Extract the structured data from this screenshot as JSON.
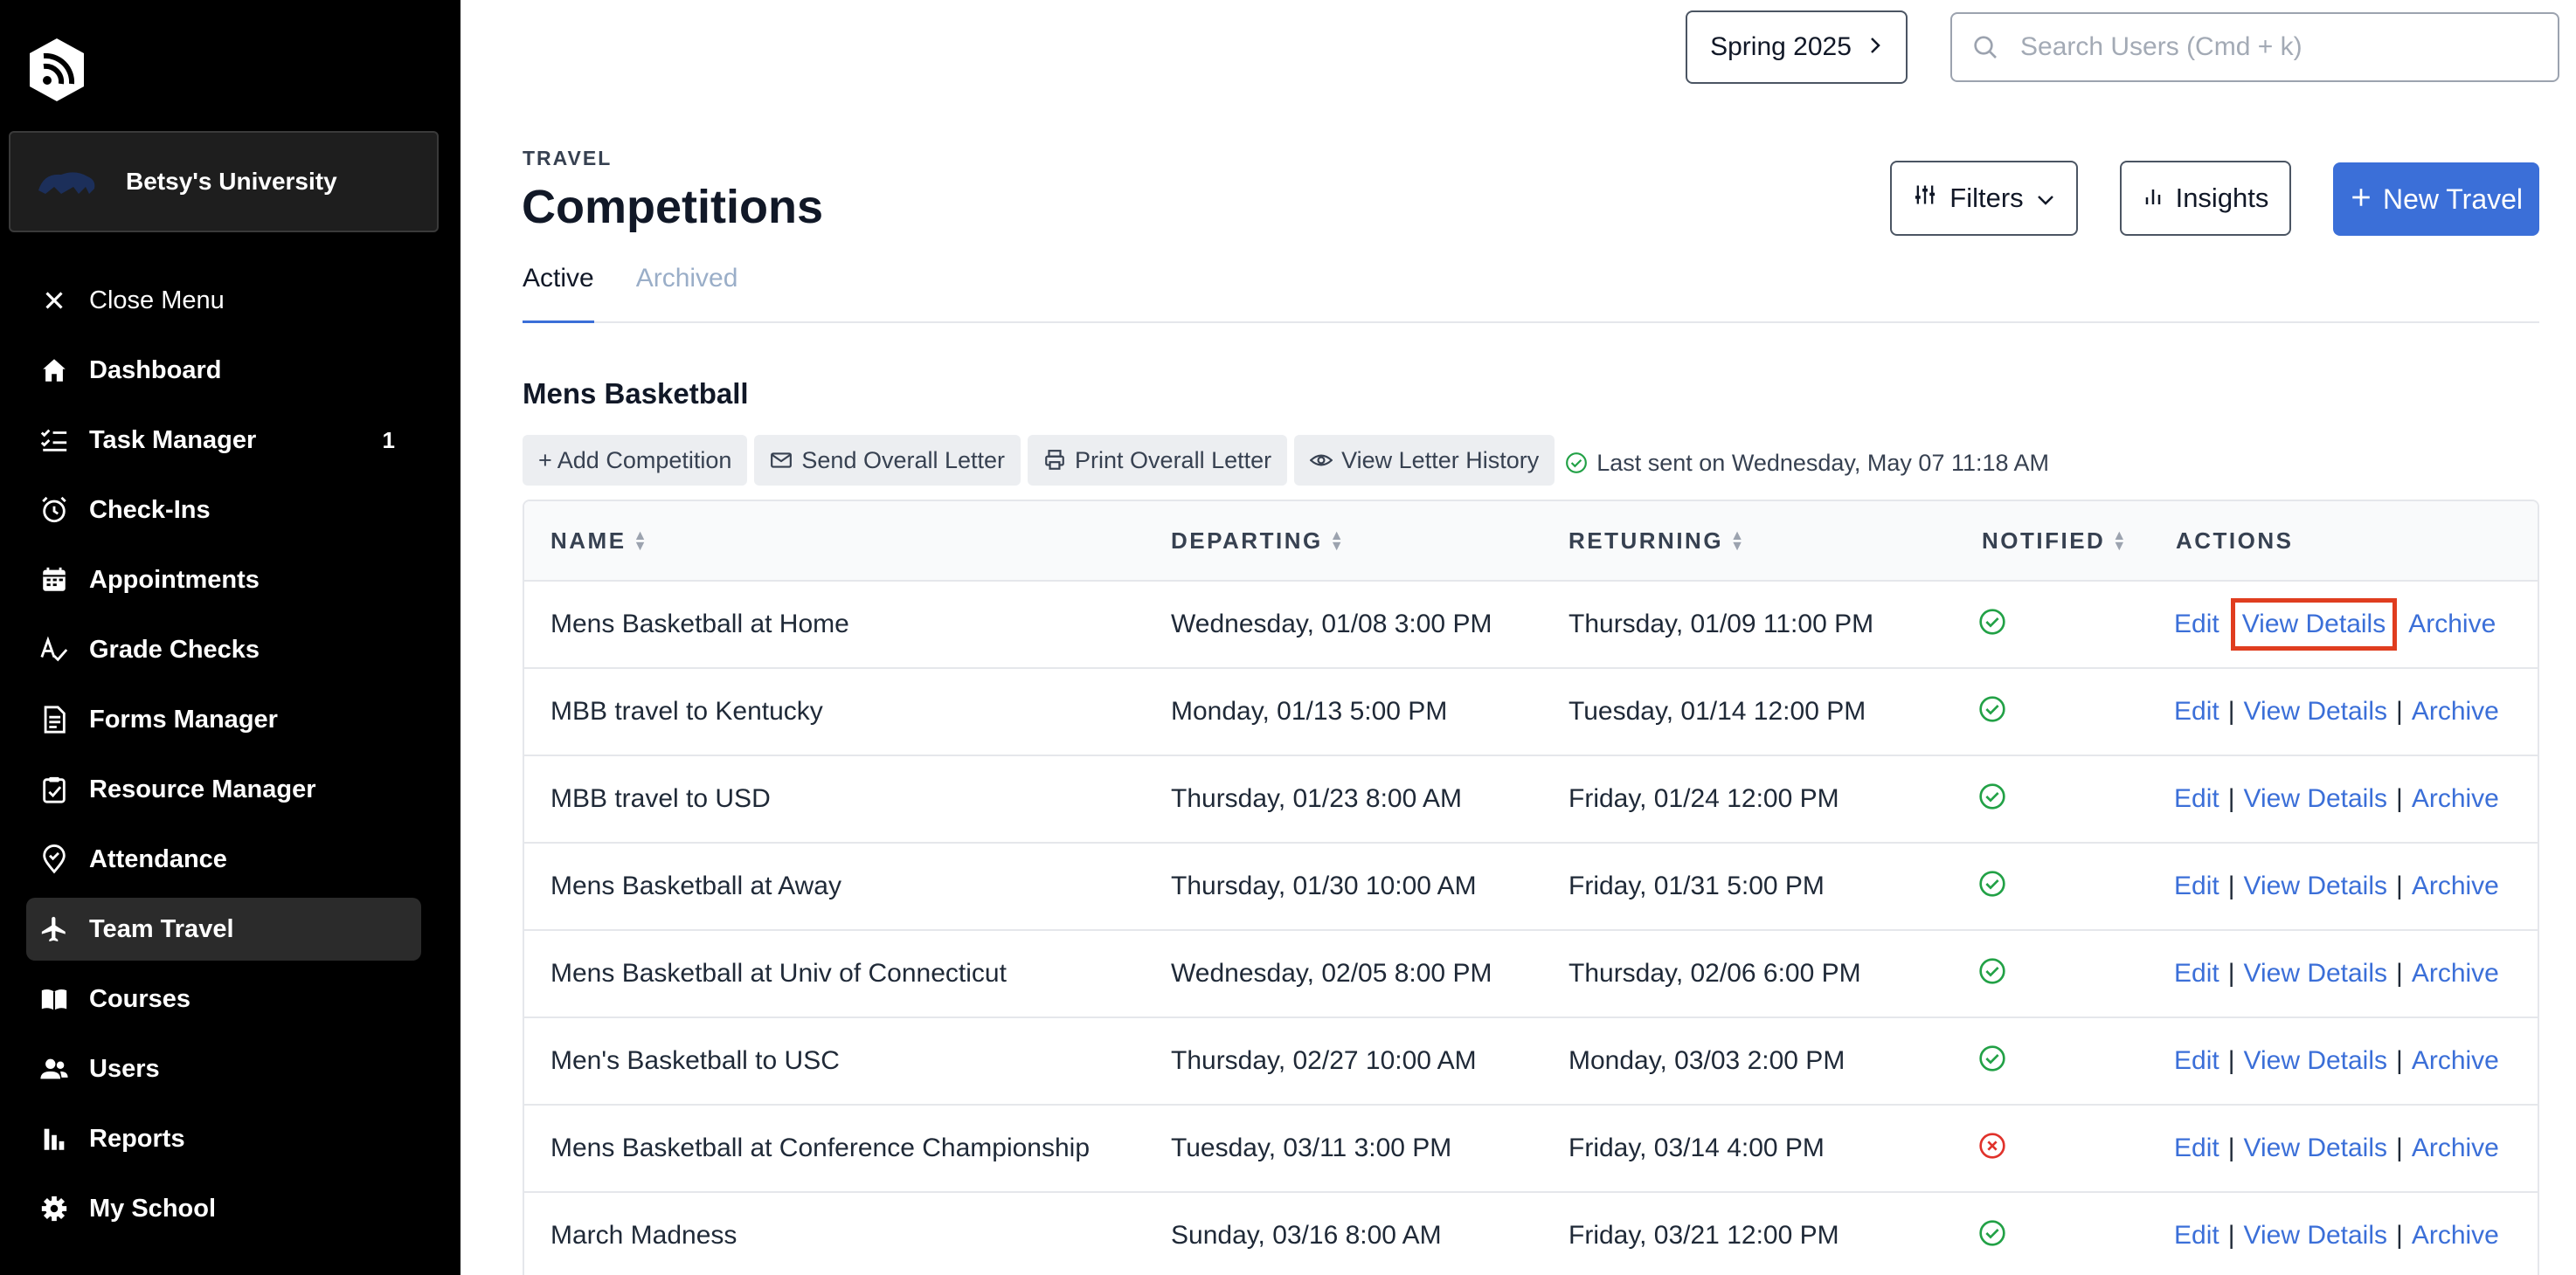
{
  "sidebar": {
    "org_name": "Betsy's University",
    "items": [
      {
        "label": "Close Menu",
        "icon": "close-icon"
      },
      {
        "label": "Dashboard",
        "icon": "home-icon"
      },
      {
        "label": "Task Manager",
        "icon": "checklist-icon",
        "badge": "1"
      },
      {
        "label": "Check-Ins",
        "icon": "alarm-clock-icon"
      },
      {
        "label": "Appointments",
        "icon": "calendar-icon"
      },
      {
        "label": "Grade Checks",
        "icon": "grade-check-icon"
      },
      {
        "label": "Forms Manager",
        "icon": "document-icon"
      },
      {
        "label": "Resource Manager",
        "icon": "clipboard-icon"
      },
      {
        "label": "Attendance",
        "icon": "location-check-icon"
      },
      {
        "label": "Team Travel",
        "icon": "airplane-icon",
        "active": true
      },
      {
        "label": "Courses",
        "icon": "book-icon"
      },
      {
        "label": "Users",
        "icon": "users-icon"
      },
      {
        "label": "Reports",
        "icon": "bar-chart-icon"
      },
      {
        "label": "My School",
        "icon": "gear-icon"
      }
    ]
  },
  "topbar": {
    "term": "Spring 2025",
    "search_placeholder": "Search Users (Cmd + k)"
  },
  "header": {
    "section": "TRAVEL",
    "title": "Competitions",
    "filters_label": "Filters",
    "insights_label": "Insights",
    "new_label": "New Travel",
    "tabs": [
      "Active",
      "Archived"
    ]
  },
  "group": {
    "title": "Mens Basketball",
    "toolbar": {
      "add": "+ Add Competition",
      "send": "Send Overall Letter",
      "print": "Print Overall Letter",
      "history": "View Letter History",
      "last_sent": "Last sent on Wednesday, May 07 11:18 AM"
    }
  },
  "table": {
    "columns": [
      "NAME",
      "DEPARTING",
      "RETURNING",
      "NOTIFIED",
      "ACTIONS"
    ],
    "actions": {
      "edit": "Edit",
      "view": "View Details",
      "archive": "Archive",
      "sep": "|"
    },
    "rows": [
      {
        "name": "Mens Basketball at Home",
        "departing": "Wednesday, 01/08 3:00 PM",
        "returning": "Thursday, 01/09 11:00 PM",
        "notified": true
      },
      {
        "name": "MBB travel to Kentucky",
        "departing": "Monday, 01/13 5:00 PM",
        "returning": "Tuesday, 01/14 12:00 PM",
        "notified": true
      },
      {
        "name": "MBB travel to USD",
        "departing": "Thursday, 01/23 8:00 AM",
        "returning": "Friday, 01/24 12:00 PM",
        "notified": true
      },
      {
        "name": "Mens Basketball at Away",
        "departing": "Thursday, 01/30 10:00 AM",
        "returning": "Friday, 01/31 5:00 PM",
        "notified": true
      },
      {
        "name": "Mens Basketball at Univ of Connecticut",
        "departing": "Wednesday, 02/05 8:00 PM",
        "returning": "Thursday, 02/06 6:00 PM",
        "notified": true
      },
      {
        "name": "Men's Basketball to USC",
        "departing": "Thursday, 02/27 10:00 AM",
        "returning": "Monday, 03/03 2:00 PM",
        "notified": true
      },
      {
        "name": "Mens Basketball at Conference Championship",
        "departing": "Tuesday, 03/11 3:00 PM",
        "returning": "Friday, 03/14 4:00 PM",
        "notified": false
      },
      {
        "name": "March Madness",
        "departing": "Sunday, 03/16 8:00 AM",
        "returning": "Friday, 03/21 12:00 PM",
        "notified": true
      }
    ]
  },
  "colors": {
    "accent": "#3b6fd8",
    "success": "#22a146",
    "danger": "#e0322b",
    "highlight": "#e03d1f"
  }
}
